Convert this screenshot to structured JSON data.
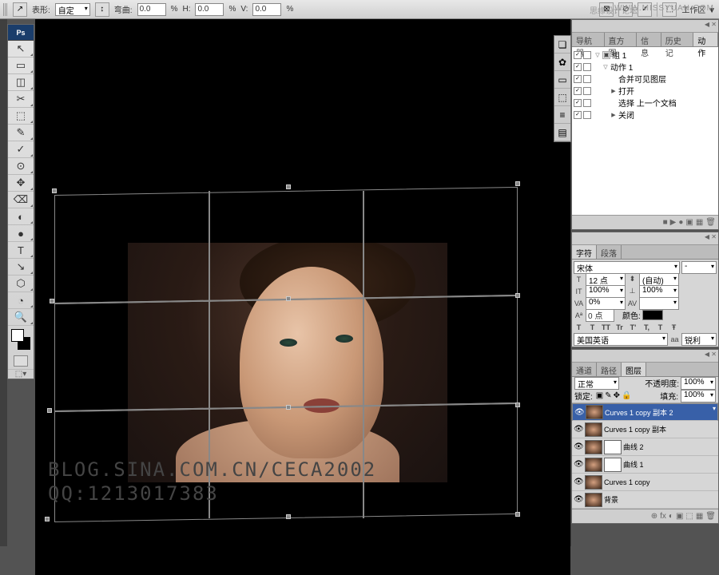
{
  "watermark": {
    "left": "思缘设计论坛",
    "right": "WWW.MISSYUAN.COM"
  },
  "optbar": {
    "shape_icon": "↗",
    "shape_label": "表形:",
    "shape_value": "自定",
    "bend_label": "弯曲:",
    "bend_value": "0.0",
    "pct": "%",
    "h_label": "H:",
    "h_value": "0.0",
    "v_label": "V:",
    "v_value": "0.0",
    "work_label": "工作区 ▼"
  },
  "tools": [
    "↖",
    "▭",
    "◫",
    "✂",
    "⬚",
    "✎",
    "✓",
    "⊙",
    "✥",
    "⌫",
    "◐",
    "●",
    "T",
    "↘",
    "⬡",
    "◔",
    "🔍"
  ],
  "canvas": {
    "wm1": "BLOG.SINA.COM.CN/CECA2002",
    "wm2": "QQ:1213017383"
  },
  "collapsed": [
    "❏",
    "✿",
    "▭",
    "⬚",
    "≡",
    "▤"
  ],
  "actions": {
    "tabs": [
      "导航器",
      "直方图",
      "信息",
      "历史记",
      "动作"
    ],
    "active": 4,
    "items": [
      {
        "indent": 0,
        "fold": true,
        "icon": "▣",
        "label": "组 1"
      },
      {
        "indent": 1,
        "fold": true,
        "icon": "",
        "label": "动作 1"
      },
      {
        "indent": 2,
        "fold": false,
        "icon": "",
        "label": "合并可见图层"
      },
      {
        "indent": 2,
        "fold": false,
        "exp": "▶",
        "icon": "",
        "label": "打开"
      },
      {
        "indent": 2,
        "fold": false,
        "icon": "",
        "label": "选择 上一个文档"
      },
      {
        "indent": 2,
        "fold": false,
        "exp": "▶",
        "icon": "",
        "label": "关闭"
      }
    ],
    "footer": [
      "■",
      "▶",
      "●",
      "▣",
      "▦",
      "🗑"
    ]
  },
  "char": {
    "tabs": [
      "字符",
      "段落"
    ],
    "active": 0,
    "font": "宋体",
    "style": "-",
    "size_icon": "T",
    "size": "12 点",
    "lead_icon": "⬍",
    "lead": "(自动)",
    "vscale_icon": "IT",
    "vscale": "100%",
    "hscale_icon": "⊥",
    "hscale": "100%",
    "va_icon": "VA",
    "va": "0%",
    "av_icon": "AV",
    "av": "",
    "base_icon": "Aª",
    "base": "0 点",
    "color_lbl": "颜色:",
    "styles": [
      "T",
      "T",
      "TT",
      "Tr",
      "T'",
      "T,",
      "T",
      "Ŧ"
    ],
    "lang": "美国英语",
    "aa_lbl": "aa",
    "aa": "锐利"
  },
  "layers": {
    "tabs": [
      "通道",
      "路径",
      "图层"
    ],
    "active": 2,
    "blend": "正常",
    "opacity_lbl": "不透明度:",
    "opacity": "100%",
    "lock_lbl": "锁定:",
    "lock_icons": [
      "▣",
      "✎",
      "✥",
      "🔒"
    ],
    "fill_lbl": "填充:",
    "fill": "100%",
    "items": [
      {
        "name": "Curves 1 copy 副本 2",
        "mask": false,
        "sel": true
      },
      {
        "name": "Curves 1 copy 副本",
        "mask": false,
        "sel": false
      },
      {
        "name": "曲线 2",
        "mask": true,
        "sel": false
      },
      {
        "name": "曲线 1",
        "mask": true,
        "sel": false
      },
      {
        "name": "Curves 1 copy",
        "mask": false,
        "sel": false
      },
      {
        "name": "背景",
        "mask": false,
        "sel": false
      }
    ],
    "footer": [
      "⊕",
      "fx",
      "◐",
      "▣",
      "⬚",
      "▦",
      "🗑"
    ]
  }
}
